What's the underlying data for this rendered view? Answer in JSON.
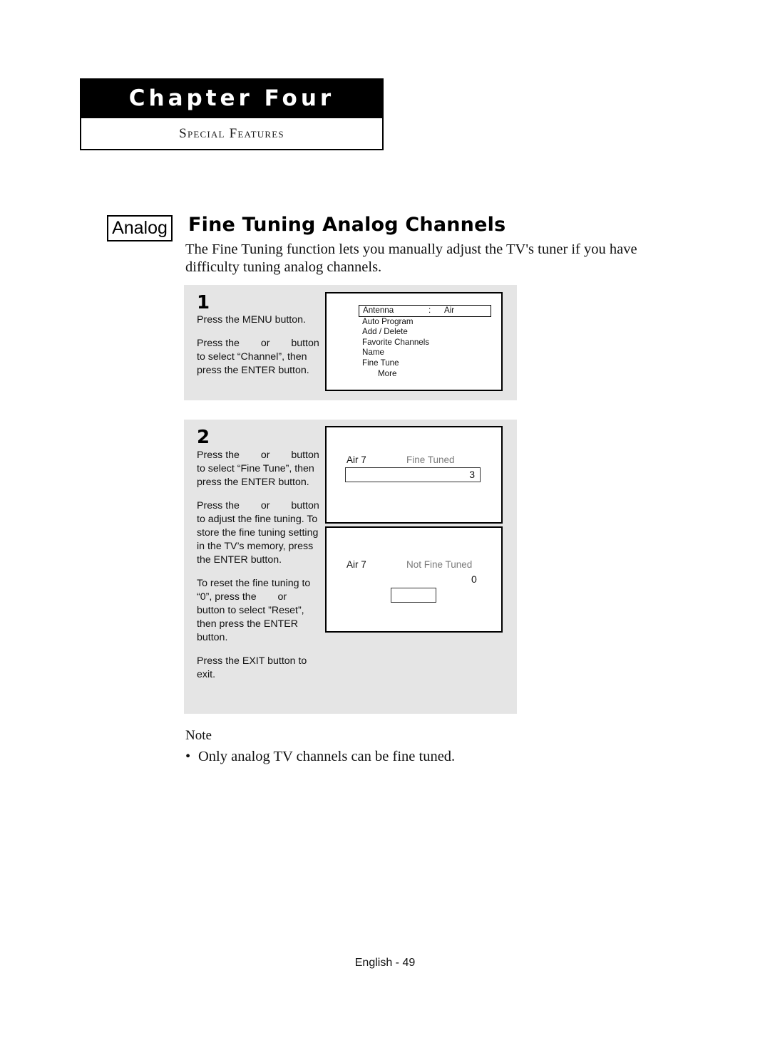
{
  "header": {
    "chapter_title": "Chapter Four",
    "chapter_subtitle": "Special Features"
  },
  "section": {
    "badge": "Analog",
    "title": "Fine Tuning Analog Channels",
    "intro": "The Fine Tuning function lets you manually adjust the TV's tuner if you have difficulty tuning analog channels."
  },
  "steps": [
    {
      "number": "1",
      "paragraphs": [
        {
          "before": "Press the MENU button.",
          "after": ""
        },
        {
          "before": "Press the ",
          "mid": " or ",
          "after": " button to select “Channel”, then press the ENTER button."
        }
      ]
    },
    {
      "number": "2",
      "paragraphs": [
        {
          "before": "Press the ",
          "mid": " or ",
          "after": " button to select “Fine Tune”, then press the ENTER button."
        },
        {
          "before": "Press the ",
          "mid": " or ",
          "after": " button to adjust the fine tuning. To store the fine tuning setting in the TV’s memory, press the ENTER button."
        },
        {
          "before": "To reset the fine tuning to “0”, press the ",
          "mid": " or ",
          "after": " button to select ”Reset”, then press the ENTER button."
        },
        {
          "before": "Press the EXIT button to exit.",
          "after": ""
        }
      ]
    }
  ],
  "tv_menu": {
    "selected_row": {
      "label": "Antenna",
      "colon": ":",
      "value": "Air"
    },
    "rows": [
      {
        "label": "Auto Program",
        "indent": false
      },
      {
        "label": "Add / Delete",
        "indent": false
      },
      {
        "label": "Favorite Channels",
        "indent": false
      },
      {
        "label": "Name",
        "indent": false
      },
      {
        "label": "Fine Tune",
        "indent": false
      },
      {
        "label": "More",
        "indent": true
      }
    ]
  },
  "tv_tuned": {
    "channel": "Air 7",
    "status": "Fine Tuned",
    "value": "3"
  },
  "tv_untuned": {
    "channel": "Air 7",
    "status": "Not Fine Tuned",
    "value": "0"
  },
  "note": {
    "title": "Note",
    "bullet": "•",
    "text": "Only analog TV channels can be fine tuned."
  },
  "footer": {
    "page_label": "English - 49"
  },
  "colors": {
    "panel_bg": "#e5e5e5",
    "status_text": "#7a7a7a",
    "header_bar": "#000000"
  }
}
